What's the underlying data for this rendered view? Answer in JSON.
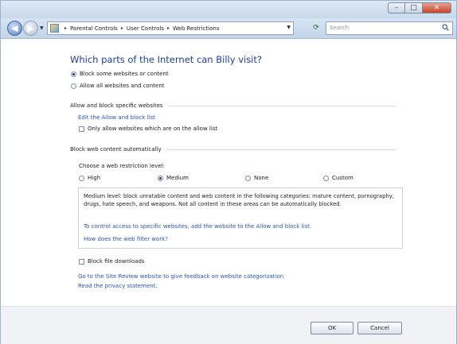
{
  "window": {
    "title_buttons": {
      "minimize": "–",
      "maximize": "□",
      "close": "✕"
    },
    "accent": "#1f3e93",
    "link_color": "#2a56b8"
  },
  "nav": {
    "back_icon": "arrow-left-icon",
    "forward_icon": "arrow-right-icon",
    "recent_icon": "chevron-down-icon",
    "breadcrumbs": [
      "Parental Controls",
      "User Controls",
      "Web Restrictions"
    ],
    "separator": "▸",
    "search_placeholder": "Search"
  },
  "main": {
    "heading": "Which parts of the Internet can Billy visit?",
    "access_options": [
      {
        "label": "Block some websites or content",
        "selected": true
      },
      {
        "label": "Allow all websites and content",
        "selected": false
      }
    ],
    "allow_block": {
      "title": "Allow and block specific websites",
      "edit_link": "Edit the Allow and block list",
      "only_allow_label": "Only allow websites which are on the allow list"
    },
    "auto_block": {
      "title": "Block web content automatically",
      "choose_label": "Choose a web restriction level:",
      "levels": [
        {
          "label": "High",
          "selected": false
        },
        {
          "label": "Medium",
          "selected": true
        },
        {
          "label": "None",
          "selected": false
        },
        {
          "label": "Custom",
          "selected": false
        }
      ],
      "description": "Medium level: block unratable content and web content in the following categories: mature content, pornography, drugs, hate speech, and weapons. Not all content in these areas can be automatically blocked.",
      "control_link": "To control access to specific websites, add the website to the Allow and block list.",
      "filter_link": "How does the web filter work?"
    },
    "block_downloads_label": "Block file downloads",
    "feedback_link": "Go to the Site Review website to give feedback on website categorization",
    "privacy_link": "Read the privacy statement."
  },
  "footer": {
    "ok": "OK",
    "cancel": "Cancel"
  }
}
